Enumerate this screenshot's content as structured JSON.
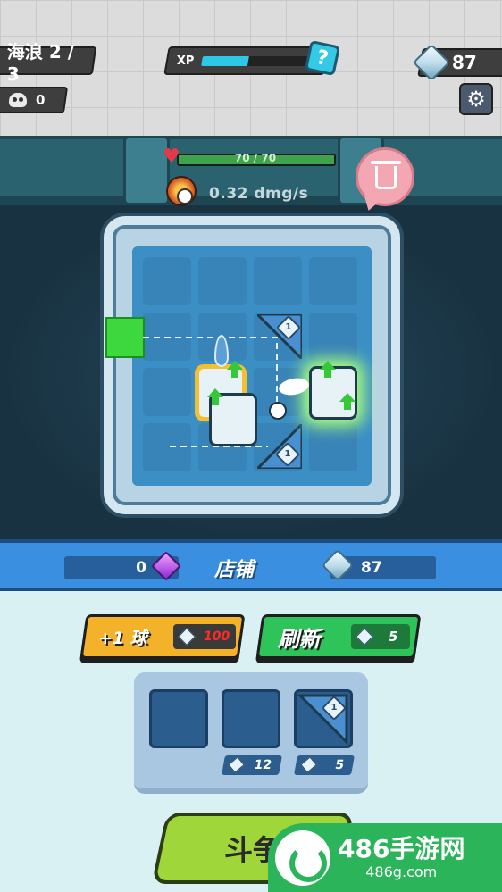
{
  "hud": {
    "wave_label": "海浪 2 / 3",
    "skull_count": "0",
    "xp_label": "XP",
    "xp_progress": 0.4,
    "help_symbol": "?",
    "gems": "87"
  },
  "arena": {
    "hp_text": "70 / 70",
    "hp_fraction": 1.0,
    "dmg_rate": "0.32 dmg/s",
    "pieces": [
      {
        "type": "deflector",
        "level": "1"
      },
      {
        "type": "deflector",
        "level": "1"
      }
    ]
  },
  "shop": {
    "title": "店铺",
    "purple_gems": "0",
    "gems": "87",
    "add_ball_button": "+1 球",
    "add_ball_cost": "100",
    "refresh_button": "刷新",
    "refresh_cost": "5",
    "slots": [
      {
        "price": "12",
        "empty": true
      },
      {
        "price": "5",
        "empty": false,
        "level": "1"
      }
    ],
    "fight_button": "斗争"
  },
  "watermark": {
    "brand": "486手游网",
    "domain": "486g.com"
  },
  "colors": {
    "xp_fill": "#2ec7e6",
    "hp_fill": "#3fa34d",
    "shop_bar": "#3b8fe0",
    "yellow_button": "#f4b12a",
    "green_button": "#2ec45a",
    "fight_button": "#9fd63a"
  }
}
